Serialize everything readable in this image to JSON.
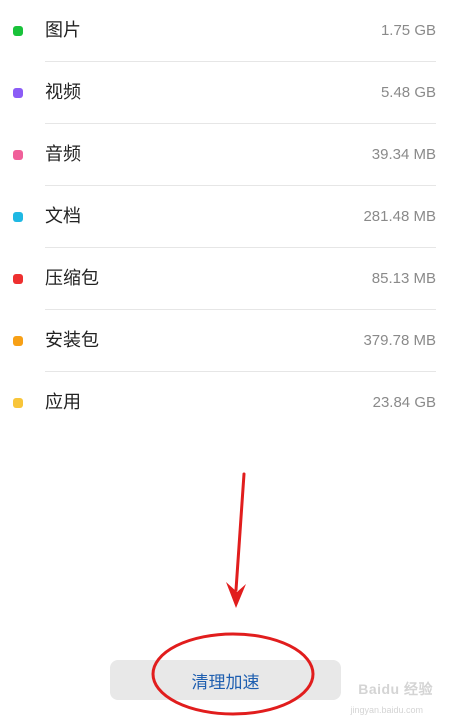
{
  "storage": {
    "items": [
      {
        "label": "图片",
        "size": "1.75 GB",
        "color": "#19c23a"
      },
      {
        "label": "视频",
        "size": "5.48 GB",
        "color": "#8b5cf6"
      },
      {
        "label": "音频",
        "size": "39.34 MB",
        "color": "#f0609a"
      },
      {
        "label": "文档",
        "size": "281.48 MB",
        "color": "#1fb8e3"
      },
      {
        "label": "压缩包",
        "size": "85.13 MB",
        "color": "#ee3030"
      },
      {
        "label": "安装包",
        "size": "379.78 MB",
        "color": "#f7a016"
      },
      {
        "label": "应用",
        "size": "23.84 GB",
        "color": "#f8c53a"
      }
    ]
  },
  "actions": {
    "clean_label": "清理加速"
  },
  "annotation": {
    "color": "#e11d1d"
  },
  "watermark": {
    "brand": "Baidu 经验",
    "domain": "jingyan.baidu.com"
  }
}
